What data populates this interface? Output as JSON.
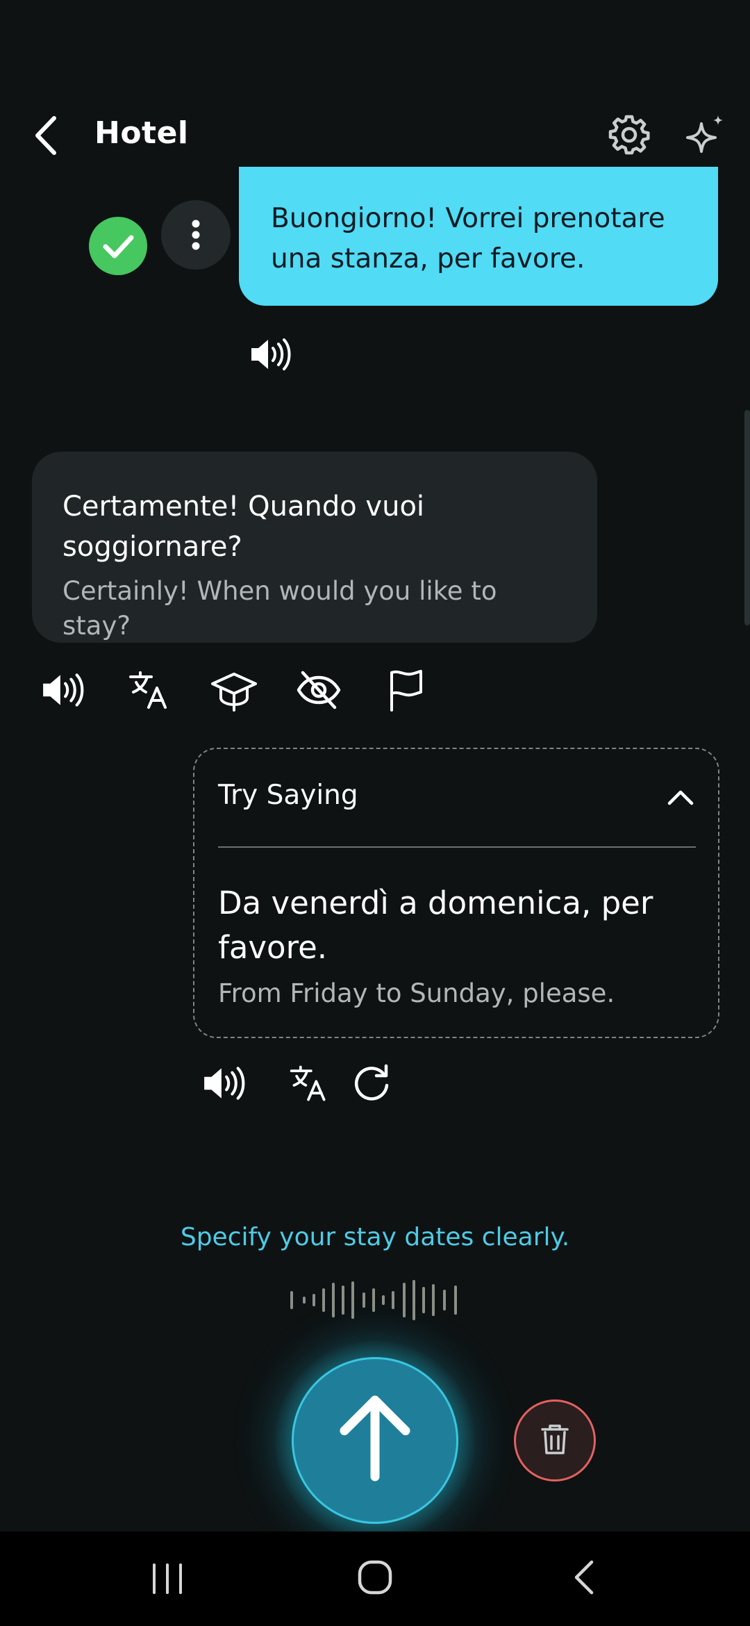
{
  "header": {
    "title": "Hotel"
  },
  "messages": {
    "user": {
      "text": "Buongiorno! Vorrei prenotare una stanza, per favore."
    },
    "ai": {
      "text": "Certamente! Quando vuoi soggiornare?",
      "translation": "Certainly! When would you like to stay?"
    }
  },
  "try_saying": {
    "title": "Try Saying",
    "text": "Da venerdì a domenica, per favore.",
    "translation": "From Friday to Sunday, please."
  },
  "hint": "Specify your stay dates clearly.",
  "icons": {
    "back": "chevron-left-icon",
    "settings": "gear-icon",
    "assistant": "sparkle-icon",
    "status": "check-icon",
    "more": "more-vertical-icon",
    "speaker": "speaker-icon",
    "translate": "translate-icon",
    "learn": "graduation-cap-icon",
    "hide": "eye-off-icon",
    "flag": "flag-icon",
    "collapse": "chevron-up-icon",
    "refresh": "refresh-icon",
    "send": "arrow-up-icon",
    "delete": "trash-icon"
  },
  "colors": {
    "background": "#0e1213",
    "user_bubble": "#51dbf5",
    "ai_bubble": "#202627",
    "accent": "#4ecbe6",
    "success": "#46c760",
    "danger": "#e2625f",
    "send_button": "#1f7f9a"
  }
}
